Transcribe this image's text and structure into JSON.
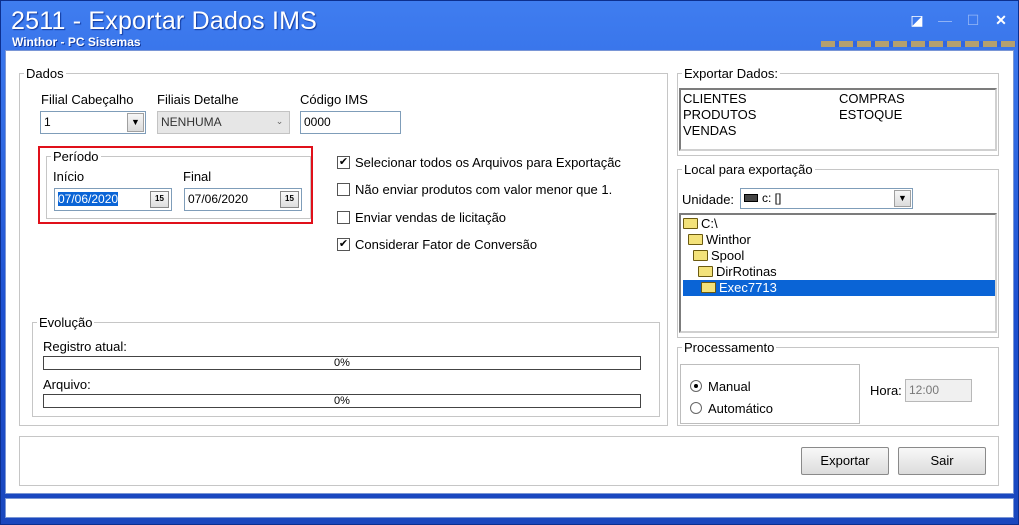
{
  "window": {
    "title": "2511 - Exportar Dados IMS",
    "subtitle": "Winthor - PC Sistemas",
    "controls": {
      "help": "◪",
      "minimize": "—",
      "maximize": "☐",
      "close": "✕"
    }
  },
  "dados": {
    "legend": "Dados",
    "filial_cabecalho": {
      "label": "Filial Cabeçalho",
      "value": "1"
    },
    "filiais_detalhe": {
      "label": "Filiais Detalhe",
      "value": "NENHUMA"
    },
    "codigo_ims": {
      "label": "Código IMS",
      "value": "0000"
    },
    "periodo": {
      "legend": "Período",
      "inicio": {
        "label": "Início",
        "value": "07/06/2020"
      },
      "final": {
        "label": "Final",
        "value": "07/06/2020"
      },
      "calendar_glyph": "15"
    },
    "options": [
      {
        "label": "Selecionar todos os Arquivos para Exportaçãc",
        "checked": true
      },
      {
        "label": "Não enviar produtos com valor menor que 1.",
        "checked": false
      },
      {
        "label": "Enviar vendas de licitação",
        "checked": false
      },
      {
        "label": "Considerar Fator de Conversão",
        "checked": true
      }
    ],
    "evolucao": {
      "legend": "Evolução",
      "registro_atual": {
        "label": "Registro atual:",
        "value": "0%"
      },
      "arquivo": {
        "label": "Arquivo:",
        "value": "0%"
      }
    }
  },
  "exportar_dados": {
    "legend": "Exportar Dados:",
    "items": [
      "CLIENTES",
      "COMPRAS",
      "PRODUTOS",
      "ESTOQUE",
      "VENDAS"
    ]
  },
  "local": {
    "legend": "Local para exportação",
    "unidade_label": "Unidade:",
    "unidade_value": "c: []",
    "tree": [
      {
        "label": "C:\\",
        "selected": false
      },
      {
        "label": "Winthor",
        "selected": false
      },
      {
        "label": "Spool",
        "selected": false
      },
      {
        "label": "DirRotinas",
        "selected": false
      },
      {
        "label": "Exec7713",
        "selected": true
      }
    ]
  },
  "processamento": {
    "legend": "Processamento",
    "manual": "Manual",
    "automatico": "Automático",
    "selected": "Manual",
    "hora_label": "Hora:",
    "hora_value": "12:00"
  },
  "buttons": {
    "exportar": "Exportar",
    "sair": "Sair"
  },
  "colors": {
    "title_bg": "#2a5fe0",
    "selection": "#0a64d6",
    "highlight_box": "#e0101a"
  }
}
